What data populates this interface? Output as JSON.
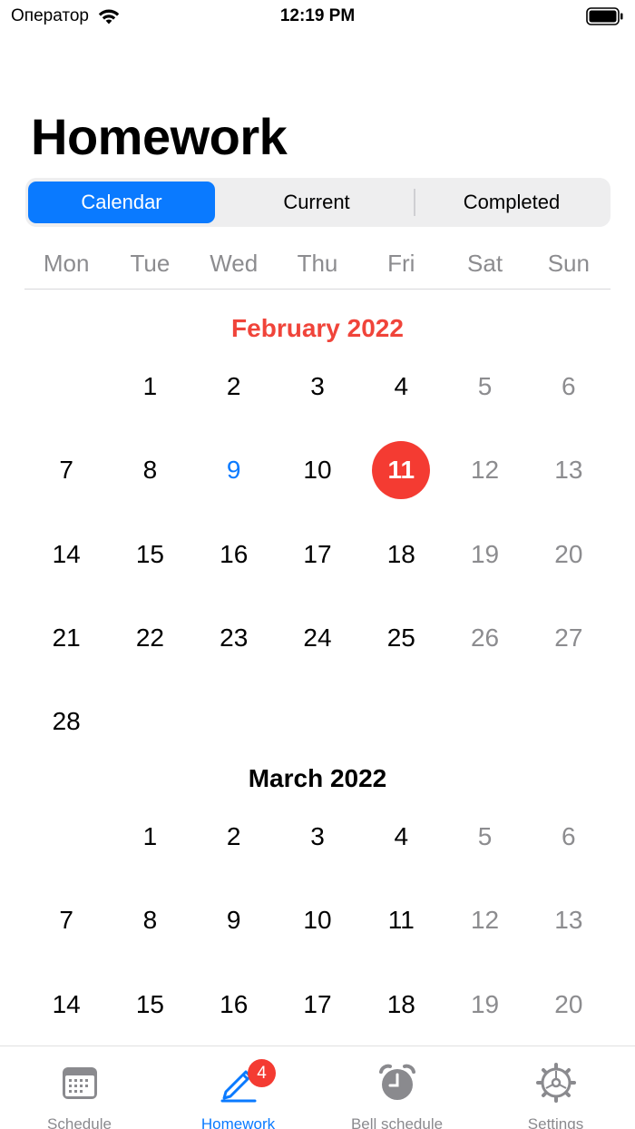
{
  "status_bar": {
    "carrier": "Оператор",
    "time": "12:19 PM"
  },
  "title": "Homework",
  "segments": [
    "Calendar",
    "Current",
    "Completed"
  ],
  "segment_selected": "Calendar",
  "weekdays": [
    "Mon",
    "Tue",
    "Wed",
    "Thu",
    "Fri",
    "Sat",
    "Sun"
  ],
  "months": [
    {
      "title": "February 2022",
      "is_current": true,
      "weeks": [
        [
          "",
          "1",
          "2",
          "3",
          "4",
          "5",
          "6"
        ],
        [
          "7",
          "8",
          "9",
          "10",
          "11",
          "12",
          "13"
        ],
        [
          "14",
          "15",
          "16",
          "17",
          "18",
          "19",
          "20"
        ],
        [
          "21",
          "22",
          "23",
          "24",
          "25",
          "26",
          "27"
        ],
        [
          "28",
          "",
          "",
          "",
          "",
          "",
          ""
        ]
      ],
      "today": "11",
      "selected": "9"
    },
    {
      "title": "March 2022",
      "is_current": false,
      "weeks": [
        [
          "",
          "1",
          "2",
          "3",
          "4",
          "5",
          "6"
        ],
        [
          "7",
          "8",
          "9",
          "10",
          "11",
          "12",
          "13"
        ],
        [
          "14",
          "15",
          "16",
          "17",
          "18",
          "19",
          "20"
        ]
      ]
    }
  ],
  "tabs": [
    {
      "label": "Schedule",
      "icon": "calendar-icon"
    },
    {
      "label": "Homework",
      "icon": "pencil-icon",
      "badge": "4",
      "active": true
    },
    {
      "label": "Bell schedule",
      "icon": "alarm-clock-icon"
    },
    {
      "label": "Settings",
      "icon": "gear-icon"
    }
  ],
  "colors": {
    "accent": "#0a7aff",
    "today": "#f43b32",
    "weekend": "#8c8c8f"
  }
}
